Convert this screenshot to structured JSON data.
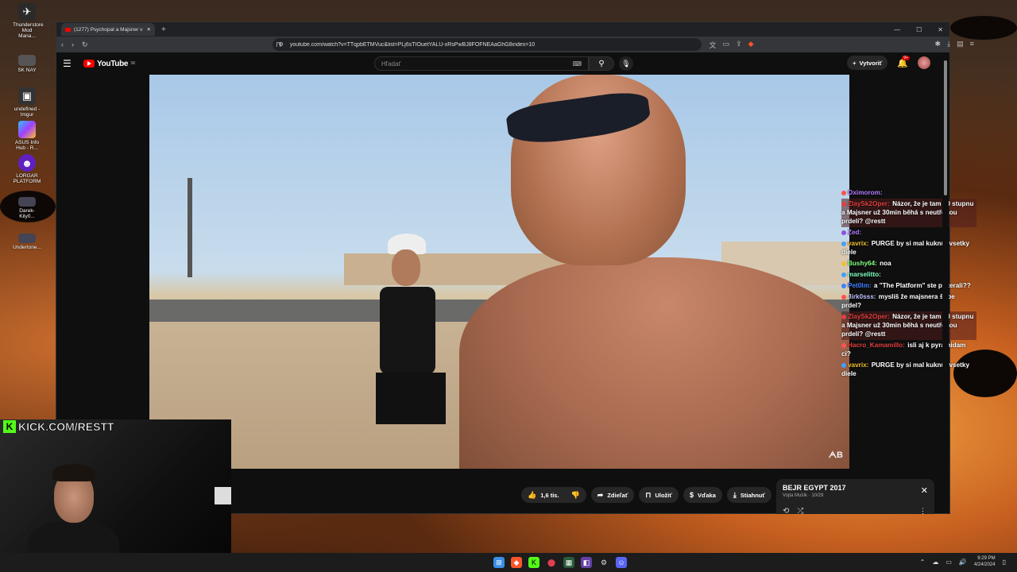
{
  "desktop": {
    "icons": [
      {
        "label": "Thunderstore Mod Mana...",
        "icon": "thunderstore-icon"
      },
      {
        "label": "SK NAY",
        "icon": "file-icon"
      },
      {
        "label": "undefined - Imgur",
        "icon": "imgur-icon"
      },
      {
        "label": "ASUS Info Hub - R...",
        "icon": "asus-icon"
      },
      {
        "label": "LORGAR PLATFORM",
        "icon": "lorgar-icon"
      },
      {
        "label": "Darek-Kily0...",
        "icon": "file-icon"
      },
      {
        "label": "Undertone...",
        "icon": "file-icon"
      }
    ]
  },
  "browser": {
    "tab_title": "(1277) Psychopat a Majsner v",
    "url": "youtube.com/watch?v=TTqpbETMVuc&list=PLj6sTIOuetYALU-xRsPwBJ8FOFNEAaGhG8index=10"
  },
  "youtube": {
    "logo_text": "YouTube",
    "region": "SK",
    "search_placeholder": "Hľadať",
    "create_label": "Vytvoriť",
    "notifications": "9+"
  },
  "chat": [
    {
      "user": "Oximorom:",
      "text": "",
      "user_color": "#b07cff",
      "badge_color": "#ff5050",
      "highlight": false
    },
    {
      "user": "ZlaySk2Oper:",
      "text": "Názor, že je tam 40 stupnu a Majsner už 30min běhá s neutřenou prdelí? @restt",
      "user_color": "#e04040",
      "badge_color": "#e04040",
      "highlight": true
    },
    {
      "user": "Zed:",
      "text": "",
      "user_color": "#b07cff",
      "badge_color": "#9050e0",
      "highlight": false
    },
    {
      "user": "vavrix:",
      "text": "PURGE by si mal kuknut vsetky diele",
      "user_color": "#f0c030",
      "badge_color": "#40a0ff",
      "highlight": false
    },
    {
      "user": "Bushy64:",
      "text": "noa",
      "user_color": "#80ff80",
      "badge_color": "#f0c030",
      "highlight": false
    },
    {
      "user": "marselitto:",
      "text": "",
      "user_color": "#80ffc0",
      "badge_color": "#40a0ff",
      "highlight": false
    },
    {
      "user": "Pet0lm:",
      "text": "a \"The Platform\" ste pozerali??",
      "user_color": "#4080ff",
      "badge_color": "#4080ff",
      "highlight": false
    },
    {
      "user": "Jirk0sss:",
      "text": "myslíš že majsnera štípe prdel?",
      "user_color": "#c0c0ff",
      "badge_color": "#ff5050",
      "highlight": false
    },
    {
      "user": "ZlaySk2Oper:",
      "text": "Názor, že je tam 40 stupnu a Majsner už 30min běhá s neutřenou prdelí? @restt",
      "user_color": "#e04040",
      "badge_color": "#e04040",
      "highlight": true
    },
    {
      "user": "Hacro_Kamamillo:",
      "text": "isli aj k pyramidam ci?",
      "user_color": "#e04040",
      "badge_color": "#ff5050",
      "highlight": false
    },
    {
      "user": "vavrix:",
      "text": "PURGE by si mal kuknut vsetky diele",
      "user_color": "#f0c030",
      "badge_color": "#40a0ff",
      "highlight": false
    }
  ],
  "actions": {
    "like_count": "1,6 tis.",
    "share": "Zdieľať",
    "save": "Uložiť",
    "thanks": "Vďaka",
    "download": "Stiahnuť"
  },
  "playlist": {
    "title": "BEJR EGYPT 2017",
    "subtitle": "Vojta Mušík · 10/29"
  },
  "stream": {
    "kick_url": "KICK.COM/RESTT"
  },
  "taskbar": {
    "time": "9:29 PM",
    "date": "4/24/2024"
  },
  "colors": {
    "accent_red": "#ff0000",
    "kick_green": "#53fc18"
  }
}
